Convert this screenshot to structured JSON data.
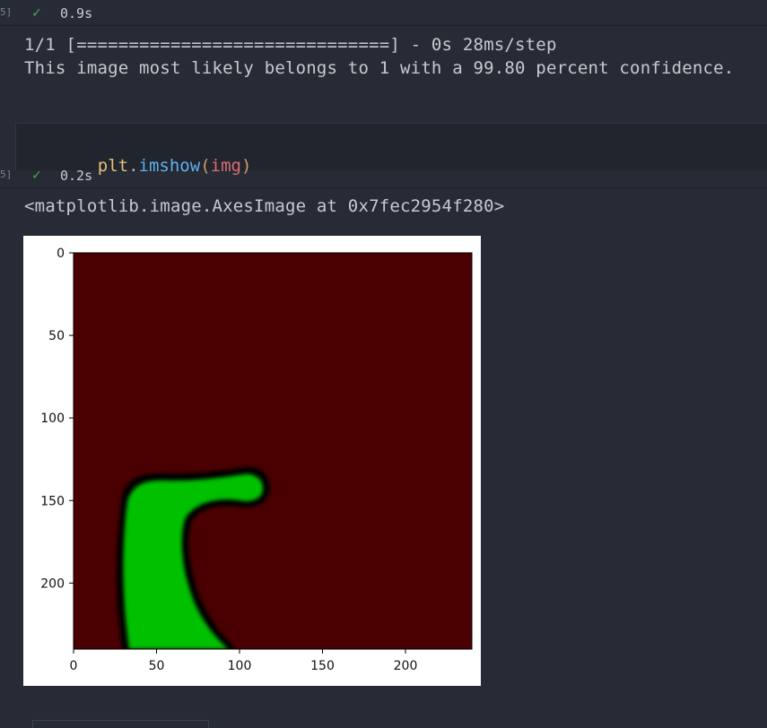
{
  "cell1": {
    "exec_bracket": "5]",
    "check_icon": "check-icon",
    "elapsed": "0.9s"
  },
  "output1": {
    "line1": "1/1 [==============================] - 0s 28ms/step",
    "line2": "This image most likely belongs to 1 with a 99.80 percent confidence."
  },
  "cell2": {
    "code_var": "plt",
    "code_dot": ".",
    "code_fn": "imshow",
    "code_open": "(",
    "code_arg": "img",
    "code_close": ")",
    "exec_bracket": "5]",
    "check_icon": "check-icon",
    "elapsed": "0.2s"
  },
  "output2": {
    "repr": "<matplotlib.image.AxesImage at 0x7fec2954f280>"
  },
  "colors": {
    "background": "#262b35",
    "image_background": "#4a0000",
    "shape_fill": "#00c000",
    "shape_edge": "#000000",
    "success": "#4caf50"
  },
  "chart_data": {
    "type": "heatmap",
    "title": "",
    "xlabel": "",
    "ylabel": "",
    "xlim": [
      0,
      240
    ],
    "ylim": [
      240,
      0
    ],
    "x_ticks": [
      "0",
      "50",
      "100",
      "150",
      "200"
    ],
    "y_ticks": [
      "0",
      "50",
      "100",
      "150",
      "200"
    ],
    "x_tick_values": [
      0,
      50,
      100,
      150,
      200
    ],
    "y_tick_values": [
      0,
      50,
      100,
      150,
      200
    ],
    "grid": false,
    "description_of_content": "dark red background with a green blob in lower-left"
  }
}
